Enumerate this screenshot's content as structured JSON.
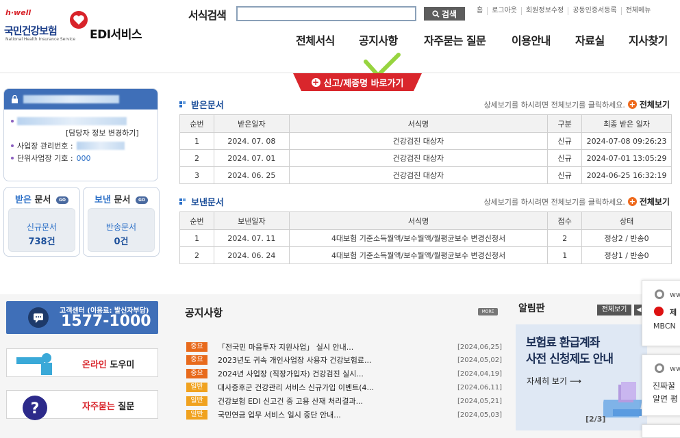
{
  "header": {
    "logo_hwell": "h·well",
    "logo_korname": "국민건강보험",
    "logo_engname": "National Health Insurance Service",
    "logo_edi": "EDI서비스",
    "search_label": "서식검색",
    "search_value": "",
    "search_button": "검색",
    "util_nav": [
      "홈",
      "로그아웃",
      "회원정보수정",
      "공동인증서등록",
      "전체메뉴"
    ],
    "gnb": [
      "전체서식",
      "공지사항",
      "자주묻는 질문",
      "이용안내",
      "자료실",
      "지사찾기"
    ],
    "report_button": "신고/제증명 바로가기"
  },
  "user": {
    "manager_bracket": "[담당자 정보 변경하기]",
    "workplace_label": "사업장 관리번호 :",
    "unit_label": "단위사업장 기호 :",
    "unit_value": "000",
    "received": {
      "title_a": "받은",
      "title_b": "문서",
      "sub": "신규문서",
      "count": "738건"
    },
    "sent": {
      "title_a": "보낸",
      "title_b": "문서",
      "sub": "반송문서",
      "count": "0건"
    },
    "go": "GO"
  },
  "received_docs": {
    "title": "받은문서",
    "hint": "상세보기를 하시려면 전체보기를 클릭하세요.",
    "view_all": "전체보기",
    "headers": [
      "순번",
      "받은일자",
      "서식명",
      "구분",
      "최종 받은 일자"
    ],
    "rows": [
      [
        "1",
        "2024. 07. 08",
        "건강검진 대상자",
        "신규",
        "2024-07-08 09:26:23"
      ],
      [
        "2",
        "2024. 07. 01",
        "건강검진 대상자",
        "신규",
        "2024-07-01 13:05:29"
      ],
      [
        "3",
        "2024. 06. 25",
        "건강검진 대상자",
        "신규",
        "2024-06-25 16:32:19"
      ]
    ]
  },
  "sent_docs": {
    "title": "보낸문서",
    "hint": "상세보기를 하시려면 전체보기를 클릭하세요.",
    "view_all": "전체보기",
    "headers": [
      "순번",
      "보낸일자",
      "서식명",
      "접수",
      "상태"
    ],
    "rows": [
      [
        "1",
        "2024. 07. 11",
        "4대보험 기준소득월액/보수월액/월평균보수 변경신청서",
        "2",
        "정상2 / 반송0"
      ],
      [
        "2",
        "2024. 06. 24",
        "4대보험 기준소득월액/보수월액/월평균보수 변경신청서",
        "1",
        "정상1 / 반송0"
      ]
    ]
  },
  "call_center": {
    "label": "고객센터 (이용료: 발신자부담)",
    "number": "1577-1000"
  },
  "help": {
    "online_a": "온라인",
    "online_b": "도우미",
    "faq_a": "자주묻는",
    "faq_b": "질문"
  },
  "notices": {
    "title": "공지사항",
    "more": "MORE",
    "items": [
      {
        "badge": "중요",
        "type": "imp",
        "text": "「전국민 마음투자 지원사업」 실시 안내...",
        "date": "[2024,06,25]"
      },
      {
        "badge": "중요",
        "type": "imp",
        "text": "2023년도 귀속 개인사업장 사용자 건강보험료...",
        "date": "[2024,05,02]"
      },
      {
        "badge": "중요",
        "type": "imp",
        "text": "2024년 사업장 (직장가입자) 건강검진 실시...",
        "date": "[2024,04,19]"
      },
      {
        "badge": "일반",
        "type": "gen",
        "text": "대사증후군 건강관리 서비스 신규가입 이벤트(4...",
        "date": "[2024,06,11]"
      },
      {
        "badge": "일반",
        "type": "gen",
        "text": "건강보험 EDI 신고건 중 고용 산재 처리결과...",
        "date": "[2024,05,21]"
      },
      {
        "badge": "일반",
        "type": "gen",
        "text": "국민연금 업무 서비스 일시 중단 안내...",
        "date": "[2024,05,03]"
      }
    ]
  },
  "board": {
    "title": "알림판",
    "view_all": "전체보기",
    "banner_line1": "보험료 환급계좌",
    "banner_line2": "사전 신청제도 안내",
    "banner_more": "자세히 보기",
    "pager": "[2/3]"
  },
  "popups": {
    "p1_a": "ww",
    "p1_b": "제",
    "p1_c": "MBCN",
    "p2_a": "ww",
    "p2_b": "진짜꿀",
    "p2_c": "알면 평"
  }
}
